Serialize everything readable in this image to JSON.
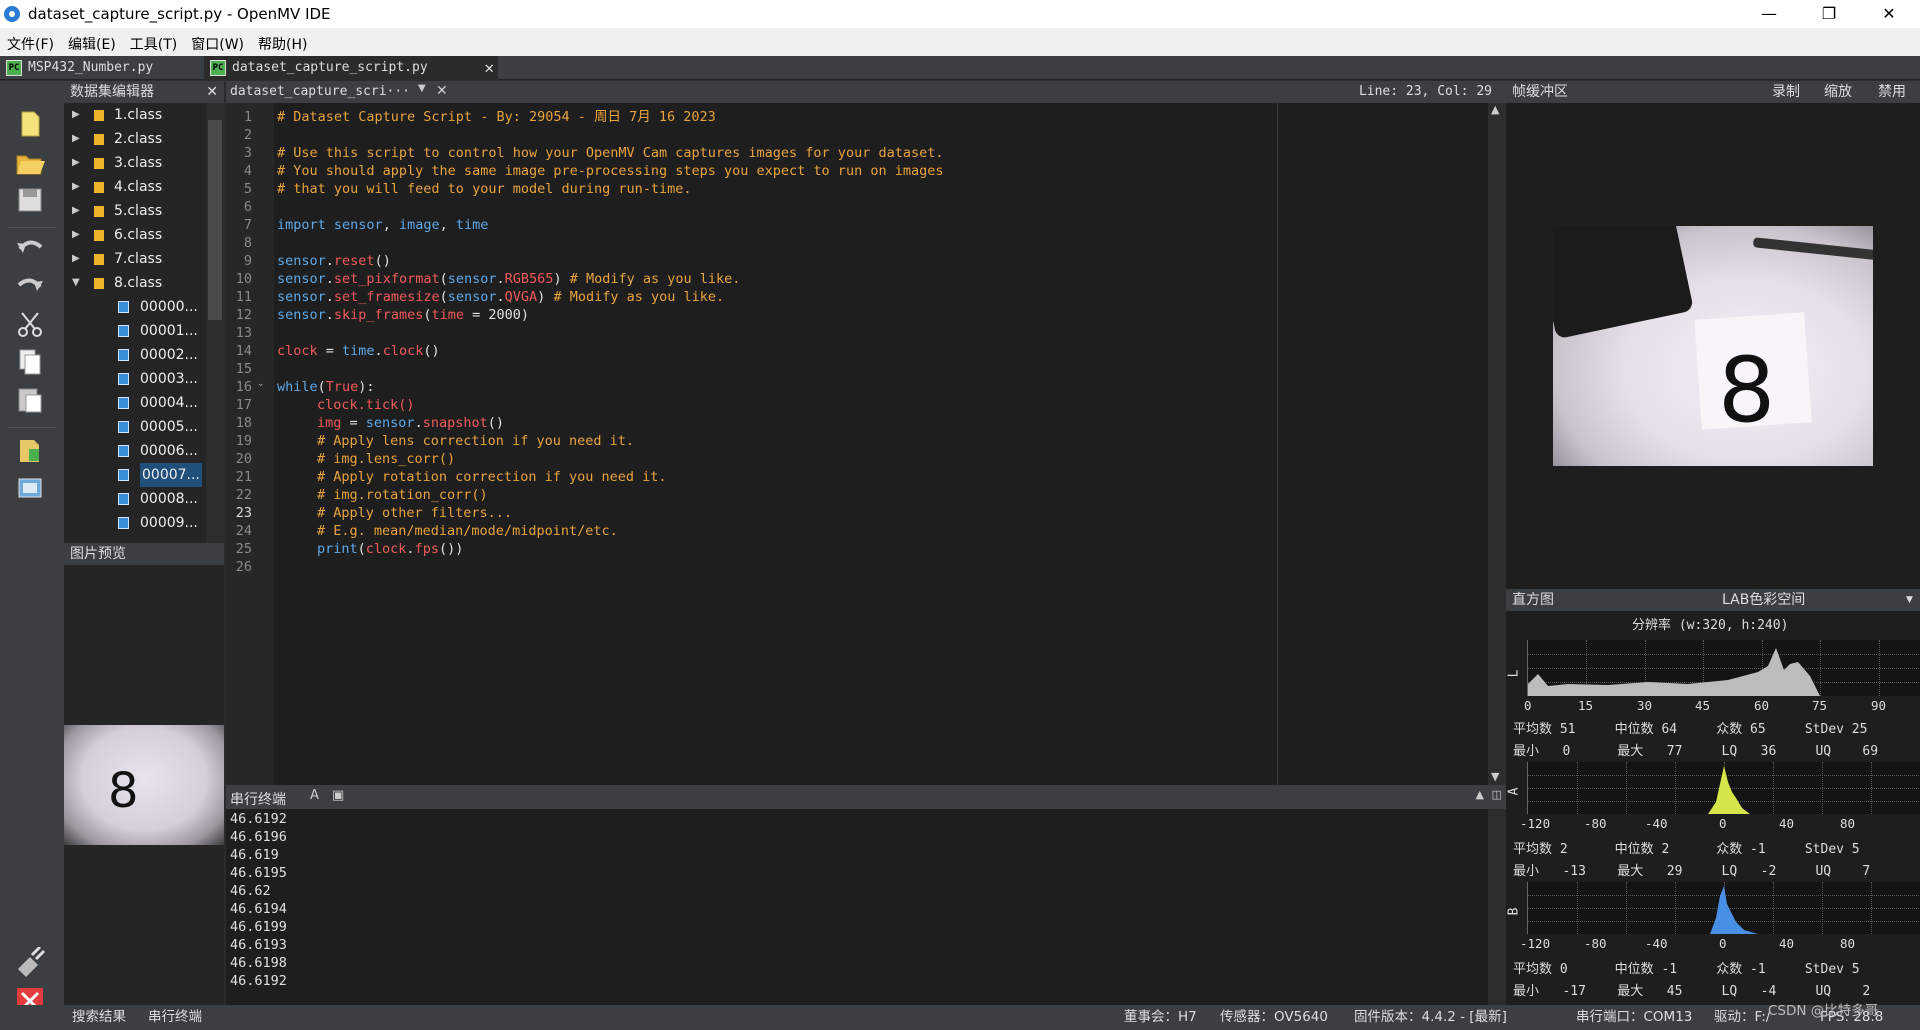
{
  "window": {
    "title": "dataset_capture_script.py - OpenMV IDE",
    "minimize": "—",
    "restore": "❐",
    "close": "✕"
  },
  "menu": [
    "文件(F)",
    "编辑(E)",
    "工具(T)",
    "窗口(W)",
    "帮助(H)"
  ],
  "file_tabs": [
    {
      "label": "MSP432_Number.py"
    },
    {
      "label": "dataset_capture_script.py"
    }
  ],
  "dataset_editor": {
    "title": "数据集编辑器",
    "folders": [
      "1.class",
      "2.class",
      "3.class",
      "4.class",
      "5.class",
      "6.class",
      "7.class",
      "8.class"
    ],
    "files": [
      "00000...",
      "00001...",
      "00002...",
      "00003...",
      "00004...",
      "00005...",
      "00006...",
      "00007...",
      "00008...",
      "00009..."
    ],
    "selected_file": "00007..."
  },
  "image_preview": {
    "title": "图片预览",
    "digit": "8"
  },
  "editor": {
    "file_label": "dataset_capture_scri···",
    "position": "Line: 23, Col: 29",
    "line_numbers": [
      "1",
      "2",
      "3",
      "4",
      "5",
      "6",
      "7",
      "8",
      "9",
      "10",
      "11",
      "12",
      "13",
      "14",
      "15",
      "16",
      "17",
      "18",
      "19",
      "20",
      "21",
      "22",
      "23",
      "24",
      "25",
      "26"
    ],
    "lines": {
      "l1": "# Dataset Capture Script - By: 29054 - 周日 7月 16 2023",
      "l3": "# Use this script to control how your OpenMV Cam captures images for your dataset.",
      "l4": "# You should apply the same image pre-processing steps you expect to run on images",
      "l5": "# that you will feed to your model during run-time.",
      "l17": "clock.tick()",
      "l19": "# Apply lens correction if you need it.",
      "l20": "# img.lens_corr()",
      "l21": "# Apply rotation correction if you need it.",
      "l22": "# img.rotation_corr()",
      "l23": "# Apply other filters...",
      "l24": "# E.g. mean/median/mode/midpoint/etc."
    }
  },
  "serial_terminal": {
    "title": "串行终端",
    "output": [
      "46.6192",
      "46.6196",
      "46.619",
      "46.6195",
      "46.62",
      "46.6194",
      "46.6199",
      "46.6193",
      "46.6198",
      "46.6192"
    ]
  },
  "frame_buffer": {
    "title": "帧缓冲区",
    "record": "录制",
    "zoom": "缩放",
    "disable": "禁用",
    "digit": "8"
  },
  "histogram": {
    "title": "直方图",
    "colorspace": "LAB色彩空间",
    "resolution": "分辨率 (w:320, h:240)",
    "L": {
      "label": "L",
      "ticks": [
        "0",
        "15",
        "30",
        "45",
        "60",
        "75",
        "90"
      ],
      "row1": "平均数 51     中位数 64     众数 65     StDev 25",
      "row2": "最小   0      最大   77     LQ   36     UQ    69"
    },
    "A": {
      "label": "A",
      "ticks": [
        "-120",
        "-80",
        "-40",
        "0",
        "40",
        "80"
      ],
      "row1": "平均数 2      中位数 2      众数 -1     StDev 5",
      "row2": "最小   -13    最大   29     LQ   -2     UQ    7"
    },
    "B": {
      "label": "B",
      "ticks": [
        "-120",
        "-80",
        "-40",
        "0",
        "40",
        "80"
      ],
      "row1": "平均数 0      中位数 -1     众数 -1     StDev 5",
      "row2": "最小   -17    最大   45     LQ   -4     UQ    2"
    },
    "colors": {
      "L": "#b0b0b0",
      "A": "#d6e64a",
      "B": "#4a8fe6"
    }
  },
  "status": {
    "search_results": "搜索结果",
    "serial_terminal": "串行终端",
    "board": "董事会：H7",
    "sensor": "传感器：OV5640",
    "firmware": "固件版本：4.4.2 - [最新]",
    "port": "串行端口：COM13",
    "drive": "驱动：F:/",
    "fps": "FPS: 28.8",
    "watermark": "CSDN @比特多哥"
  }
}
